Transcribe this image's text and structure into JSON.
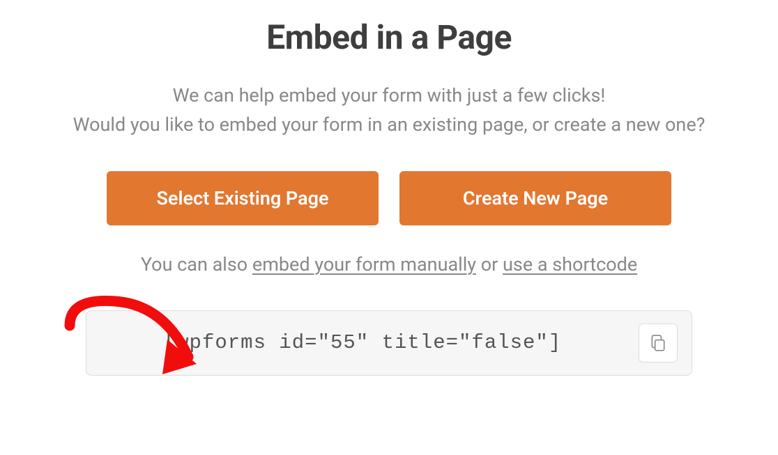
{
  "title": "Embed in a Page",
  "description_line1": "We can help embed your form with just a few clicks!",
  "description_line2": "Would you like to embed your form in an existing page, or create a new one?",
  "buttons": {
    "select_existing": "Select Existing Page",
    "create_new": "Create New Page"
  },
  "alt_text": {
    "prefix": "You can also ",
    "link_manual": "embed your form manually",
    "middle": " or ",
    "link_shortcode": "use a shortcode"
  },
  "shortcode": "[wpforms id=\"55\" title=\"false\"]",
  "colors": {
    "accent": "#e27730",
    "annotation": "#f20d0d"
  }
}
